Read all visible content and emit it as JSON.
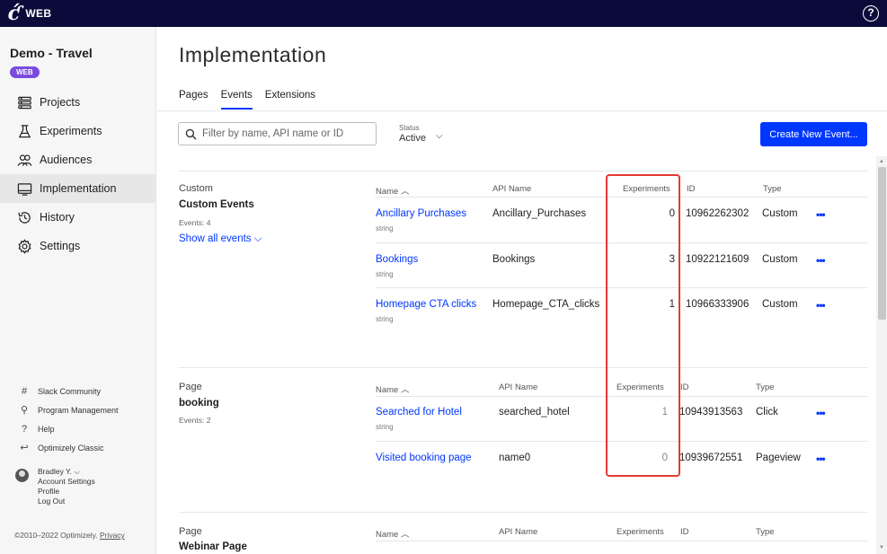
{
  "topbar": {
    "product": "WEB",
    "help": "?"
  },
  "sidebar": {
    "project": "Demo - Travel",
    "badge": "WEB",
    "nav": [
      {
        "label": "Projects",
        "icon": "projects-icon"
      },
      {
        "label": "Experiments",
        "icon": "flask-icon"
      },
      {
        "label": "Audiences",
        "icon": "audiences-icon"
      },
      {
        "label": "Implementation",
        "icon": "implementation-icon"
      },
      {
        "label": "History",
        "icon": "history-icon"
      },
      {
        "label": "Settings",
        "icon": "gear-icon"
      }
    ],
    "footer": [
      {
        "label": "Slack Community",
        "icon": "#"
      },
      {
        "label": "Program Management",
        "icon": "⚲"
      },
      {
        "label": "Help",
        "icon": "?"
      },
      {
        "label": "Optimizely Classic",
        "icon": "↩"
      }
    ],
    "user": {
      "name": "Bradley Y. ⌵",
      "account": "Account Settings",
      "profile": "Profile",
      "logout": "Log Out"
    },
    "copyright": "©2010–2022 Optimizely. ",
    "privacy": "Privacy"
  },
  "main": {
    "title": "Implementation",
    "tabs": [
      "Pages",
      "Events",
      "Extensions"
    ],
    "filter_placeholder": "Filter by name, API name or ID",
    "status_label": "Status",
    "status_value": "Active",
    "create_button": "Create New Event...",
    "columns": {
      "name": "Name ︿",
      "api": "API Name",
      "experiments": "Experiments",
      "id": "ID",
      "type": "Type"
    },
    "groups": [
      {
        "kind": "Custom",
        "name": "Custom Events",
        "count": "Events: 4",
        "show_all": "Show all events ⌵",
        "events": [
          {
            "name": "Ancillary Purchases",
            "sub": "string",
            "api": "Ancillary_Purchases",
            "experiments": "0",
            "id": "10962262302",
            "type": "Custom"
          },
          {
            "name": "Bookings",
            "sub": "string",
            "api": "Bookings",
            "experiments": "3",
            "id": "10922121609",
            "type": "Custom"
          },
          {
            "name": "Homepage CTA clicks",
            "sub": "string",
            "api": "Homepage_CTA_clicks",
            "experiments": "1",
            "id": "10966333906",
            "type": "Custom"
          }
        ]
      },
      {
        "kind": "Page",
        "name": "booking",
        "count": "Events: 2",
        "events": [
          {
            "name": "Searched for Hotel",
            "sub": "string",
            "api": "searched_hotel",
            "experiments": "1",
            "id": "10943913563",
            "type": "Click"
          },
          {
            "name": "Visited booking page",
            "sub": "",
            "api": "name0",
            "experiments": "0",
            "id": "10939672551",
            "type": "Pageview"
          }
        ]
      },
      {
        "kind": "Page",
        "name": "Webinar Page"
      }
    ],
    "more": "•••"
  },
  "colors": {
    "accent": "#0037ff",
    "topbar": "#0b0b3b",
    "badge": "#7b4be0",
    "highlight": "#e53935"
  }
}
